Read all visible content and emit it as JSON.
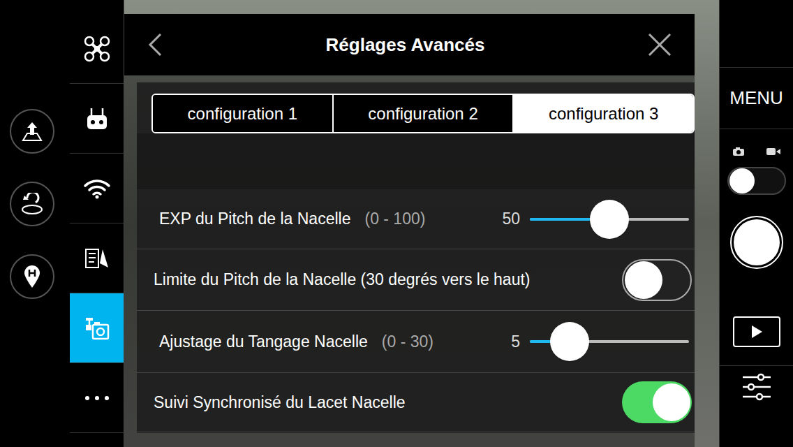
{
  "panel": {
    "title": "Réglages Avancés"
  },
  "tabs": [
    {
      "label": "configuration 1",
      "selected": false
    },
    {
      "label": "configuration 2",
      "selected": false
    },
    {
      "label": "configuration 3",
      "selected": true
    }
  ],
  "settings": [
    {
      "kind": "slider",
      "label": "EXP du Pitch de la Nacelle",
      "range": "(0 - 100)",
      "value": "50",
      "level": 0.5
    },
    {
      "kind": "toggle",
      "label": "Limite du Pitch de la Nacelle (30 degrés vers le haut)",
      "on": false
    },
    {
      "kind": "slider",
      "label": "Ajustage du Tangage Nacelle",
      "range": "(0 - 30)",
      "value": "5",
      "level": 0.167
    },
    {
      "kind": "toggle",
      "label": "Suivi Synchronisé du Lacet Nacelle",
      "on": true
    }
  ],
  "sidebar": {
    "items": [
      {
        "selected": false
      },
      {
        "selected": false
      },
      {
        "selected": false
      },
      {
        "selected": false
      },
      {
        "selected": true
      },
      {
        "selected": false
      }
    ]
  },
  "right_panel": {
    "menu": "MENU",
    "video_mode": false
  }
}
